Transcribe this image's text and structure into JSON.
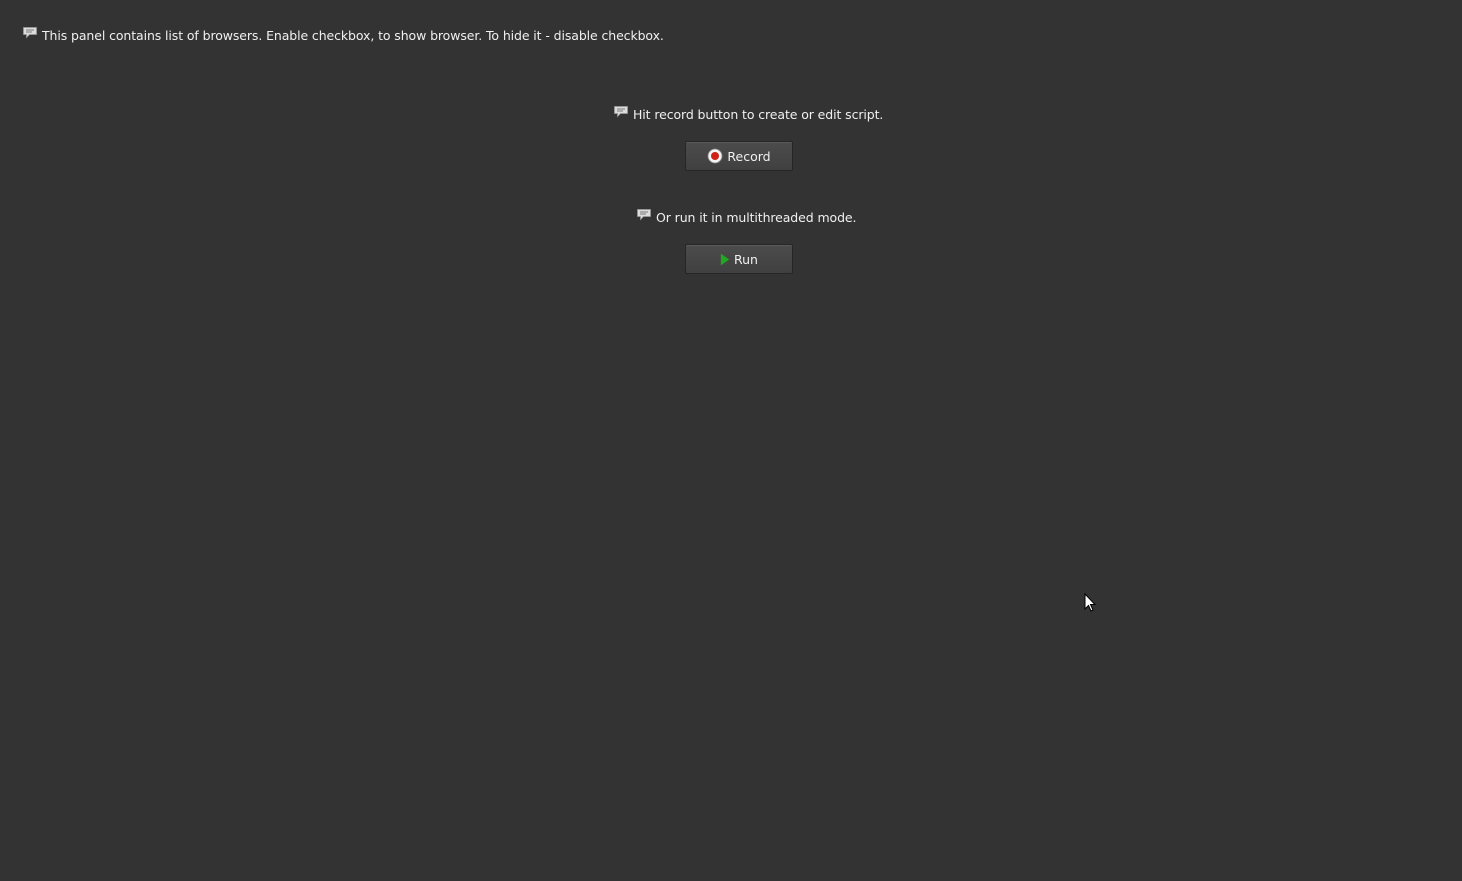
{
  "panel": {
    "info_text": "This panel contains list of browsers. Enable checkbox, to show browser. To hide it - disable checkbox."
  },
  "record_section": {
    "hint_text": "Hit record button to create or edit script.",
    "button_label": "Record",
    "icon": "record-icon",
    "icon_color": "#d0201a"
  },
  "run_section": {
    "hint_text": "Or run it in multithreaded mode.",
    "button_label": "Run",
    "icon": "play-icon",
    "icon_color": "#22a822"
  },
  "colors": {
    "background": "#333333",
    "text": "#f0f0f0",
    "button_bg": "#444444"
  }
}
